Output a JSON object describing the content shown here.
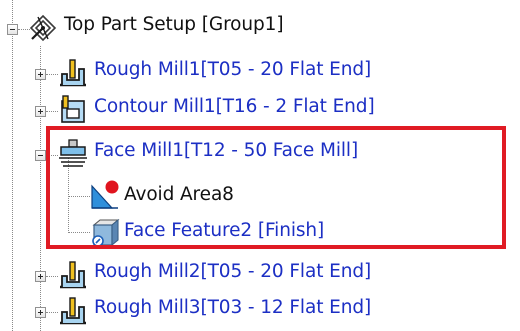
{
  "tree": {
    "root": {
      "label": "Top Part Setup [Group1]",
      "icon": "setup-compass-icon",
      "expanded": true
    },
    "operations": [
      {
        "label": "Rough Mill1[T05 - 20 Flat End]",
        "icon": "rough-mill-icon",
        "expanded": false
      },
      {
        "label": "Contour Mill1[T16 - 2 Flat End]",
        "icon": "contour-mill-icon",
        "expanded": false
      },
      {
        "label": "Face Mill1[T12 - 50 Face Mill]",
        "icon": "face-mill-icon",
        "expanded": true,
        "children": [
          {
            "label": "Avoid Area8",
            "icon": "avoid-area-icon"
          },
          {
            "label": "Face Feature2 [Finish]",
            "icon": "face-feature-icon"
          }
        ]
      },
      {
        "label": "Rough Mill2[T05 - 20 Flat End]",
        "icon": "rough-mill-icon",
        "expanded": false
      },
      {
        "label": "Rough Mill3[T03 - 12 Flat End]",
        "icon": "rough-mill-icon",
        "expanded": false
      }
    ]
  },
  "colors": {
    "operation_text": "#1c2fc4",
    "highlight_border": "#e01b24",
    "tree_lines": "#8a8a8a"
  }
}
